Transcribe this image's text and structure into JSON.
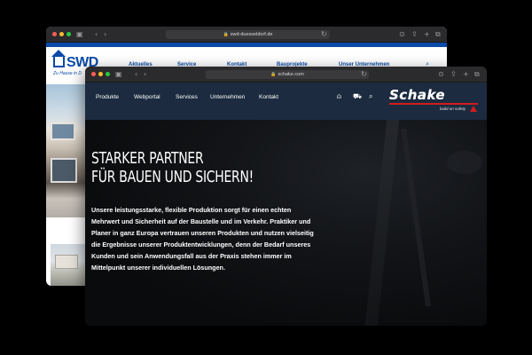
{
  "swd_window": {
    "url": "swd-duesseldorf.de",
    "logo": "SWD",
    "tagline": "Zu Hause in D",
    "menu": [
      "Aktuelles",
      "Service",
      "Kontakt",
      "Bauprojekte",
      "Unser Unternehmen"
    ]
  },
  "schake_window": {
    "url": "schake.com",
    "nav": [
      "Produkte",
      "Webportal",
      "Services",
      "Unternehmen",
      "Kontakt"
    ],
    "logo": "Schake",
    "logo_tagline": "build on safety",
    "headline": [
      "STARKER PARTNER",
      "FÜR BAUEN UND SICHERN!"
    ],
    "body_lines": [
      "Unsere leistungsstarke, flexible Produktion sorgt für einen echten",
      "Mehrwert und Sicherheit auf der Baustelle und im Verkehr. Praktiker und",
      "Planer in ganz Europa vertrauen unseren Produkten und nutzen vielseitig",
      "die Ergebnisse unserer Produktentwicklungen, denn der Bedarf unseres",
      "Kunden und sein Anwendungsfall aus der Praxis stehen immer im",
      "Mittelpunkt unserer individuellen Lösungen."
    ]
  },
  "colors": {
    "schake_nav": "#1c2b3f",
    "swd_blue": "#0a4aa8",
    "accent_red": "#d21c1c"
  }
}
